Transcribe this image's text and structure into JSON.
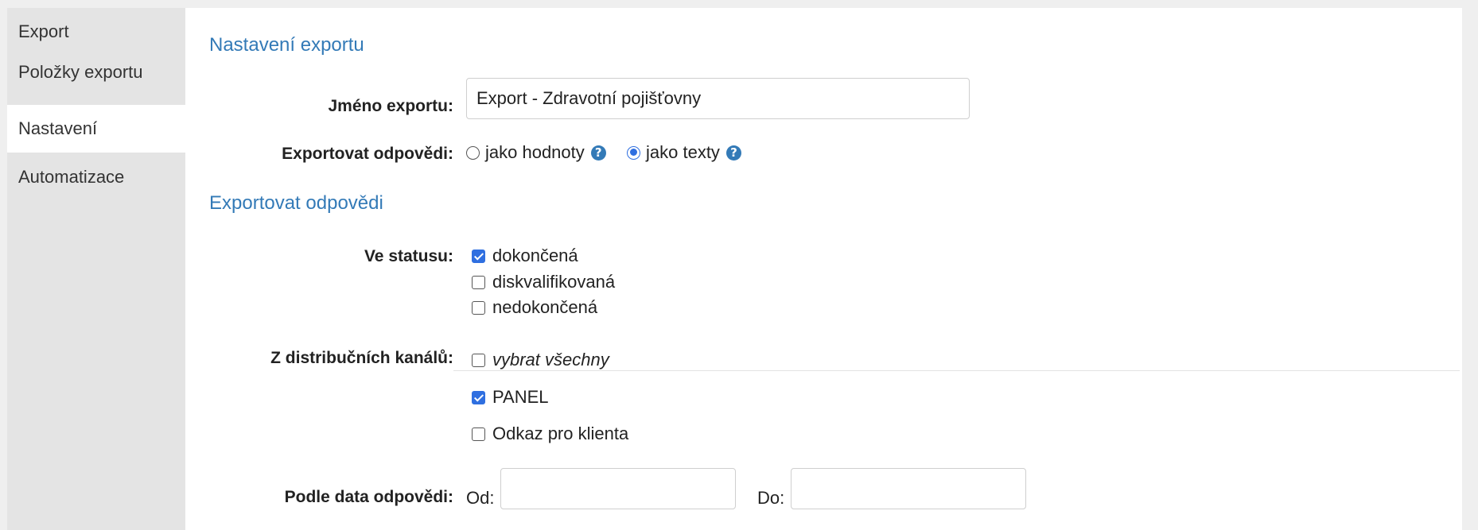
{
  "sidebar": {
    "items": [
      {
        "label": "Export"
      },
      {
        "label": "Položky exportu"
      },
      {
        "label": "Nastavení",
        "active": true
      },
      {
        "label": "Automatizace"
      }
    ]
  },
  "settings": {
    "title": "Nastavení exportu",
    "name_label": "Jméno exportu:",
    "name_value": "Export - Zdravotní pojišťovny",
    "answers_label": "Exportovat odpovědi:",
    "answers_options": [
      {
        "label": "jako hodnoty",
        "checked": false
      },
      {
        "label": "jako texty",
        "checked": true
      }
    ],
    "help_glyph": "?"
  },
  "filter": {
    "title": "Exportovat odpovědi",
    "status_label": "Ve statusu:",
    "statuses": [
      {
        "label": "dokončená",
        "checked": true
      },
      {
        "label": "diskvalifikovaná",
        "checked": false
      },
      {
        "label": "nedokončená",
        "checked": false
      }
    ],
    "channels_label": "Z distribučních kanálů:",
    "select_all": {
      "label": "vybrat všechny",
      "checked": false
    },
    "channels": [
      {
        "label": "PANEL",
        "checked": true
      },
      {
        "label": "Odkaz pro klienta",
        "checked": false
      }
    ],
    "date_label": "Podle data odpovědi:",
    "from_label": "Od:",
    "from_value": "",
    "to_label": "Do:",
    "to_value": ""
  },
  "colors": {
    "accent": "#337ab7",
    "checkbox": "#2f6fe0",
    "sidebar_bg": "#e4e4e4"
  }
}
